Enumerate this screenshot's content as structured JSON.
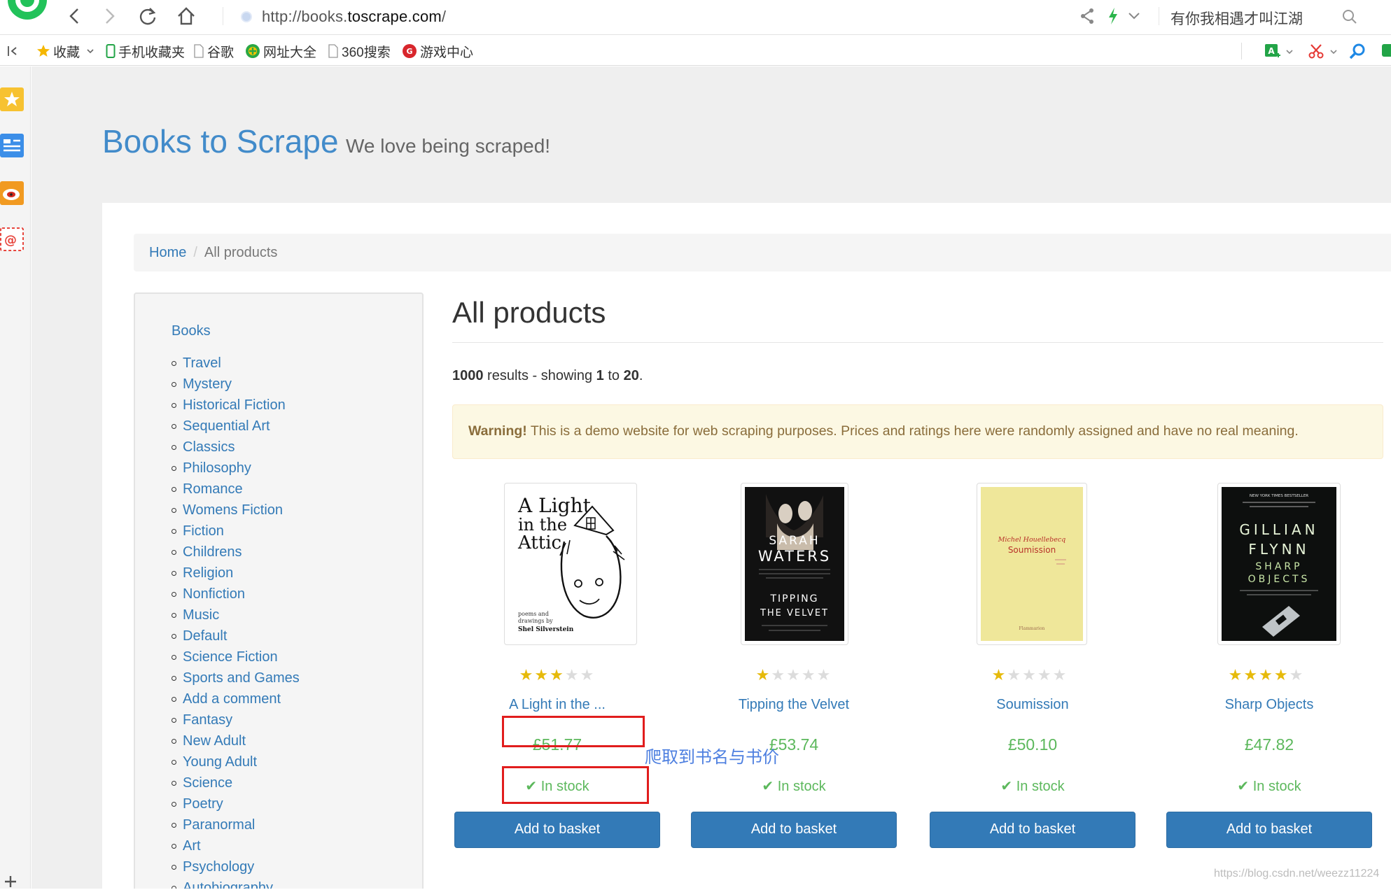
{
  "browser": {
    "url_prefix": "http://books.",
    "url_domain": "toscrape.com",
    "url_suffix": "/",
    "search_text": "有你我相遇才叫江湖",
    "bookmarks": [
      {
        "label": "收藏",
        "icon": "star-icon"
      },
      {
        "label": "手机收藏夹",
        "icon": "phone-icon"
      },
      {
        "label": "谷歌",
        "icon": "page-icon"
      },
      {
        "label": "网址大全",
        "icon": "globe-icon"
      },
      {
        "label": "360搜索",
        "icon": "page-icon"
      },
      {
        "label": "游戏中心",
        "icon": "game-icon"
      }
    ]
  },
  "site": {
    "brand": "Books to Scrape",
    "tagline": "We love being scraped!"
  },
  "breadcrumb": {
    "home": "Home",
    "separator": "/",
    "current": "All products"
  },
  "sidebar": {
    "root": "Books",
    "categories": [
      "Travel",
      "Mystery",
      "Historical Fiction",
      "Sequential Art",
      "Classics",
      "Philosophy",
      "Romance",
      "Womens Fiction",
      "Fiction",
      "Childrens",
      "Religion",
      "Nonfiction",
      "Music",
      "Default",
      "Science Fiction",
      "Sports and Games",
      "Add a comment",
      "Fantasy",
      "New Adult",
      "Young Adult",
      "Science",
      "Poetry",
      "Paranormal",
      "Art",
      "Psychology",
      "Autobiography"
    ]
  },
  "main": {
    "title": "All products",
    "results_count": "1000",
    "results_mid": " results - showing ",
    "results_from": "1",
    "results_to_word": " to ",
    "results_to": "20",
    "results_end": ".",
    "warning_label": "Warning!",
    "warning_text": " This is a demo website for web scraping purposes. Prices and ratings here were randomly assigned and have no real meaning."
  },
  "products": [
    {
      "title": "A Light in the ...",
      "price": "£51.77",
      "rating": 3,
      "stock": "In stock",
      "button": "Add to basket"
    },
    {
      "title": "Tipping the Velvet",
      "price": "£53.74",
      "rating": 1,
      "stock": "In stock",
      "button": "Add to basket"
    },
    {
      "title": "Soumission",
      "price": "£50.10",
      "rating": 1,
      "stock": "In stock",
      "button": "Add to basket"
    },
    {
      "title": "Sharp Objects",
      "price": "£47.82",
      "rating": 4,
      "stock": "In stock",
      "button": "Add to basket"
    }
  ],
  "covers": {
    "light": {
      "line1": "A Light",
      "line2": "in the",
      "line3": "Attic",
      "foot1": "poems and",
      "foot2": "drawings by",
      "author": "Shel Silverstein"
    },
    "velvet": {
      "author1": "SARAH",
      "author2": "WATERS",
      "title1": "TIPPING",
      "title2": "THE VELVET"
    },
    "soumission": {
      "author": "Michel Houellebecq",
      "title": "Soumission",
      "publisher": "Flammarion"
    },
    "sharp": {
      "banner": "NEW YORK TIMES BESTSELLER",
      "author1": "GILLIAN",
      "author2": "FLYNN",
      "title1": "SHARP",
      "title2": "OBJECTS"
    }
  },
  "annotation": "爬取到书名与书价",
  "watermark": "https://blog.csdn.net/weezz11224",
  "colors": {
    "link": "#337ab7",
    "brand": "#428bca",
    "price": "#5cb85c",
    "button": "#337ab7",
    "warning_bg": "#fcf8e3",
    "annotation_box": "#e11d1d"
  }
}
